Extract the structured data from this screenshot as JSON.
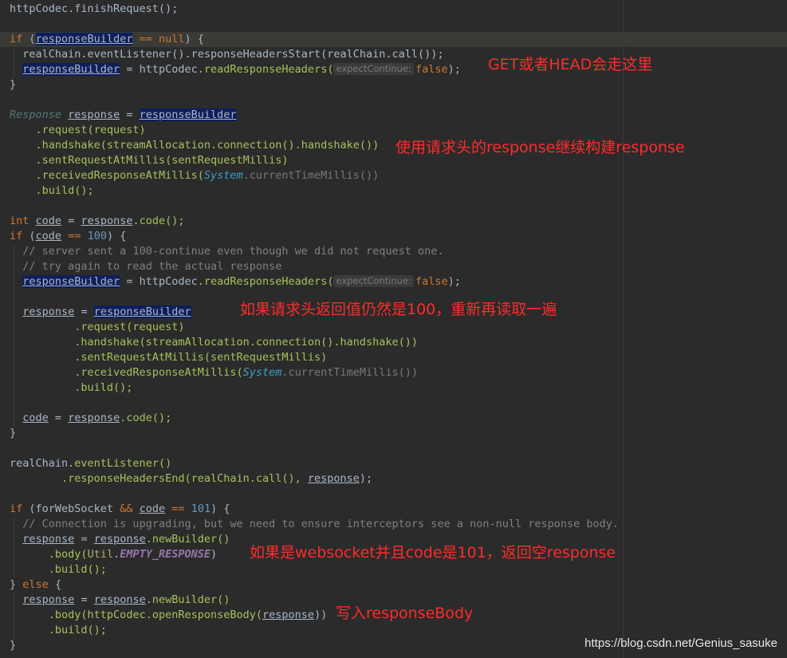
{
  "code": {
    "finish_stmt": "httpCodec.finishRequest();",
    "kw_if": "if",
    "kw_null": "null",
    "kw_int": "int",
    "kw_else": "else",
    "kw_false": "false",
    "op_eq": "==",
    "op_assign": "=",
    "op_and": "&&",
    "brace_open": "{",
    "brace_close": "}",
    "v_responseBuilder": "responseBuilder",
    "v_response": "response",
    "v_code": "code",
    "t_Response": "Response",
    "call_headers_start": "realChain.eventListener().responseHeadersStart(realChain.call());",
    "httpCodec": "httpCodec",
    "realChain": "realChain",
    "readResponseHeaders": ".readResponseHeaders(",
    "param_hint": "expectContinue:",
    "close_semicolon": ");",
    "m_request": ".request(request)",
    "m_handshake": ".handshake(streamAllocation.connection().handshake())",
    "m_sent": ".sentRequestAtMillis(sentRequestMillis)",
    "m_received": ".receivedResponseAtMillis(",
    "system": "System",
    "current_time": ".currentTimeMillis())",
    "m_build": ".build();",
    "code_call": ".code();",
    "num_100": "100",
    "num_101": "101",
    "comment_1": "// server sent a 100-continue even though we did not request one.",
    "comment_2": "// try again to read the actual response",
    "event_listener": ".eventListener()",
    "headers_end": ".responseHeadersEnd(realChain.call(), ",
    "forWebSocket": "forWebSocket",
    "comment_ws": "// Connection is upgrading, but we need to ensure interceptors see a non-null response body.",
    "new_builder": ".newBuilder()",
    "body_open": ".body(",
    "util": "Util",
    "empty_response": "EMPTY_RESPONSE",
    "body_httpcodec": ".body(httpCodec.openResponseBody(",
    "close_paren2": "))"
  },
  "annotations": {
    "get_head": "GET或者HEAD会走这里",
    "continue_build": "使用请求头的response继续构建response",
    "status_100": "如果请求头返回值仍然是100，重新再读取一遍",
    "websocket_101": "如果是websocket并且code是101，返回空response",
    "write_body": "写入responseBody"
  },
  "watermark": "https://blog.csdn.net/Genius_sasuke",
  "colors": {
    "background": "#2b2b2b",
    "annotation": "#ff2b2b",
    "keyword": "#cc7832",
    "method": "#a5c25c",
    "number": "#6897bb",
    "comment": "#808080"
  }
}
